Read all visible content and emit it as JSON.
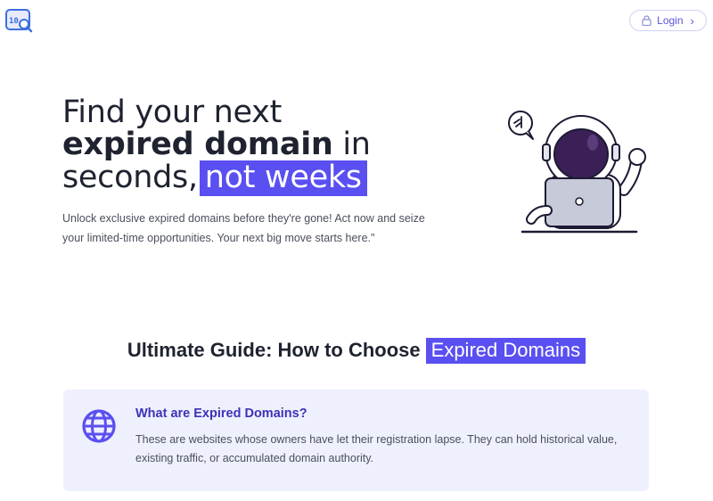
{
  "header": {
    "login_label": "Login",
    "icons": {
      "logo": "domain-search-logo-icon",
      "lock": "lock-icon",
      "chevron": "chevron-right-icon"
    }
  },
  "hero": {
    "title_line1": "Find your next",
    "title_bold": "expired domain",
    "title_line2_rest": " in",
    "title_line3": "seconds,",
    "title_highlight": "not weeks",
    "description": "Unlock exclusive expired domains before they're gone! Act now and seize your limited-time opportunities. Your next big move starts here.\"",
    "illustration": "astronaut-laptop-illustration"
  },
  "guide": {
    "title": "Ultimate Guide: How to Choose",
    "title_highlight": "Expired Domains"
  },
  "card": {
    "icon": "globe-icon",
    "title": "What are Expired Domains?",
    "text": "These are websites whose owners have let their registration lapse. They can hold historical value, existing traffic, or accumulated domain authority."
  },
  "colors": {
    "accent": "#5a4ff0",
    "card_bg": "#eff0fd",
    "card_title": "#3d33b8",
    "text_dark": "#1f2330",
    "text_muted": "#4a4f5c"
  }
}
